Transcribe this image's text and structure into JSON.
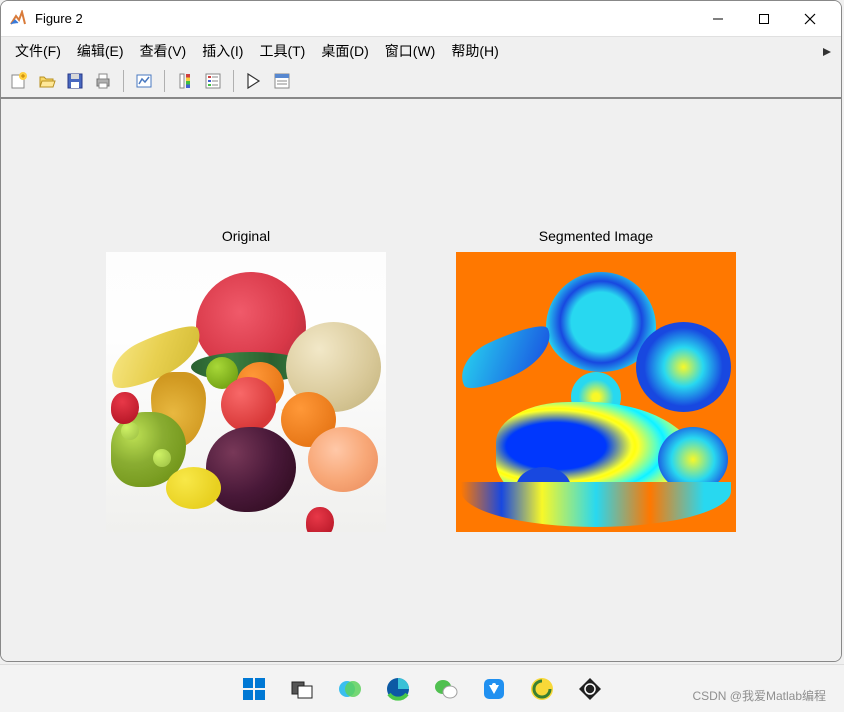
{
  "window": {
    "title": "Figure 2",
    "icon": "matlab-icon"
  },
  "menu": {
    "items": [
      {
        "label": "文件(F)",
        "name": "menu-file"
      },
      {
        "label": "编辑(E)",
        "name": "menu-edit"
      },
      {
        "label": "查看(V)",
        "name": "menu-view"
      },
      {
        "label": "插入(I)",
        "name": "menu-insert"
      },
      {
        "label": "工具(T)",
        "name": "menu-tools"
      },
      {
        "label": "桌面(D)",
        "name": "menu-desktop"
      },
      {
        "label": "窗口(W)",
        "name": "menu-window"
      },
      {
        "label": "帮助(H)",
        "name": "menu-help"
      }
    ]
  },
  "toolbar": {
    "items": [
      {
        "name": "new-figure-icon",
        "group": 1
      },
      {
        "name": "open-icon",
        "group": 1
      },
      {
        "name": "save-icon",
        "group": 1
      },
      {
        "name": "print-icon",
        "group": 1
      },
      {
        "name": "link-plot-icon",
        "group": 2
      },
      {
        "name": "insert-colorbar-icon",
        "group": 3
      },
      {
        "name": "insert-legend-icon",
        "group": 3
      },
      {
        "name": "edit-plot-icon",
        "group": 4
      },
      {
        "name": "open-property-inspector-icon",
        "group": 4
      }
    ]
  },
  "subplots": {
    "left": {
      "title": "Original",
      "name": "original-image"
    },
    "right": {
      "title": "Segmented Image",
      "name": "segmented-image"
    }
  },
  "taskbar": {
    "items": [
      {
        "name": "start-icon"
      },
      {
        "name": "task-view-icon"
      },
      {
        "name": "copilot-icon"
      },
      {
        "name": "edge-icon"
      },
      {
        "name": "wechat-icon"
      },
      {
        "name": "tim-icon"
      },
      {
        "name": "tencent-icon"
      },
      {
        "name": "other-app-icon"
      }
    ]
  },
  "watermark": "CSDN @我爱Matlab编程"
}
